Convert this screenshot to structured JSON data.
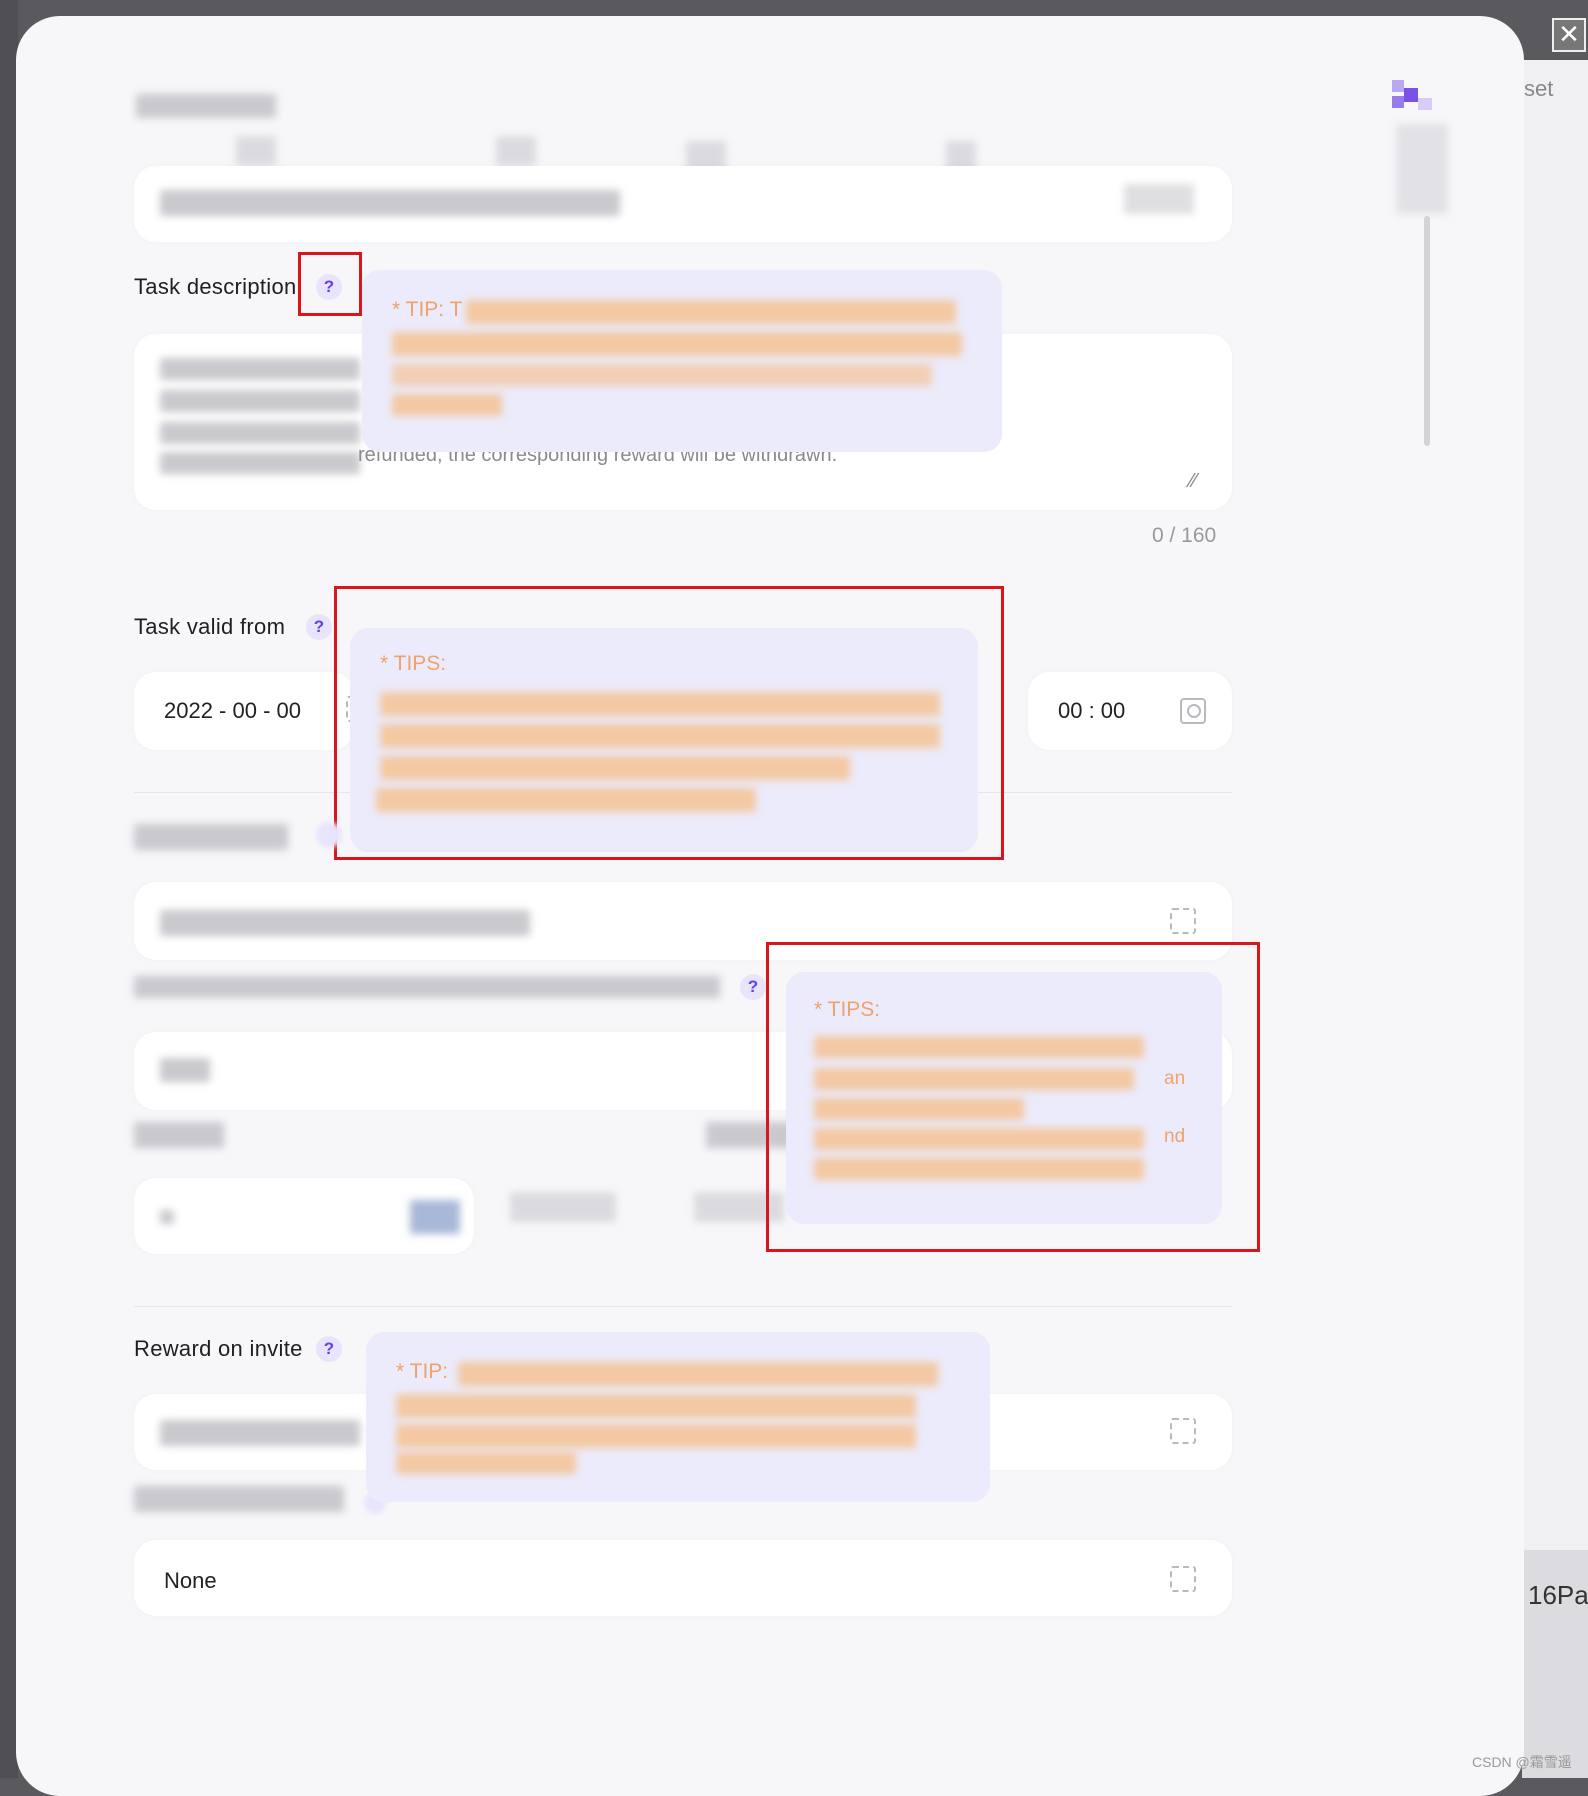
{
  "modal": {
    "close_icon": "close-icon",
    "fields": {
      "task_description": {
        "label": "Task description",
        "help": "?",
        "text_visible": "refunded, the corresponding reward will be withdrawn.",
        "counter": "0 / 160",
        "tip_title": "* TIP: T"
      },
      "task_valid_from": {
        "label": "Task valid from",
        "help": "?",
        "date_value": "2022 - 00 - 00",
        "time_value": "00 : 00",
        "tip_title": "* TIPS:"
      },
      "section_three": {
        "help": "?",
        "tip_title": "* TIPS:",
        "tip_tail_1": "an",
        "tip_tail_2": "nd"
      },
      "reward_on_invite": {
        "label": "Reward on invite",
        "help": "?",
        "tip_title": "* TIP:"
      },
      "last_field": {
        "value": "None"
      }
    }
  },
  "background": {
    "right_label": "16Pa",
    "right_top_text": "set"
  },
  "watermark": "CSDN @霜雪遥",
  "colors": {
    "highlight_border": "#d8161b",
    "tip_text": "#f0a26a",
    "tip_background": "#ecebfb",
    "help_icon": "#6a3ee0"
  }
}
